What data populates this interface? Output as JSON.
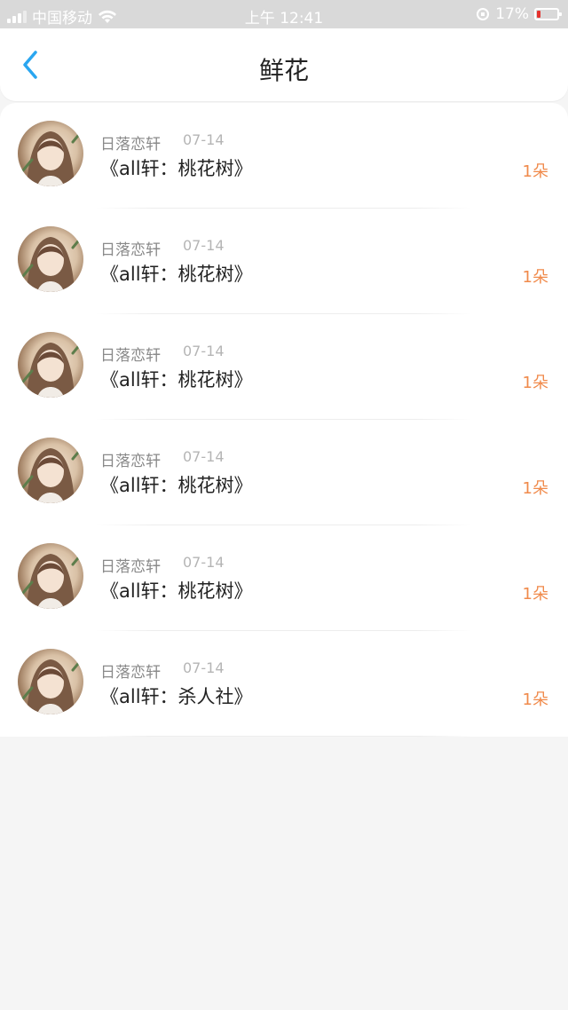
{
  "status_bar": {
    "carrier": "中国移动",
    "time": "上午 12:41",
    "battery": "17%"
  },
  "nav": {
    "title": "鲜花"
  },
  "items": [
    {
      "name": "日落恋轩",
      "date": "07-14",
      "title": "《all轩：桃花树》",
      "count": "1朵"
    },
    {
      "name": "日落恋轩",
      "date": "07-14",
      "title": "《all轩：桃花树》",
      "count": "1朵"
    },
    {
      "name": "日落恋轩",
      "date": "07-14",
      "title": "《all轩：桃花树》",
      "count": "1朵"
    },
    {
      "name": "日落恋轩",
      "date": "07-14",
      "title": "《all轩：桃花树》",
      "count": "1朵"
    },
    {
      "name": "日落恋轩",
      "date": "07-14",
      "title": "《all轩：桃花树》",
      "count": "1朵"
    },
    {
      "name": "日落恋轩",
      "date": "07-14",
      "title": "《all轩：杀人社》",
      "count": "1朵"
    }
  ],
  "colors": {
    "accent": "#2aa6f0",
    "count": "#f08a4b"
  }
}
